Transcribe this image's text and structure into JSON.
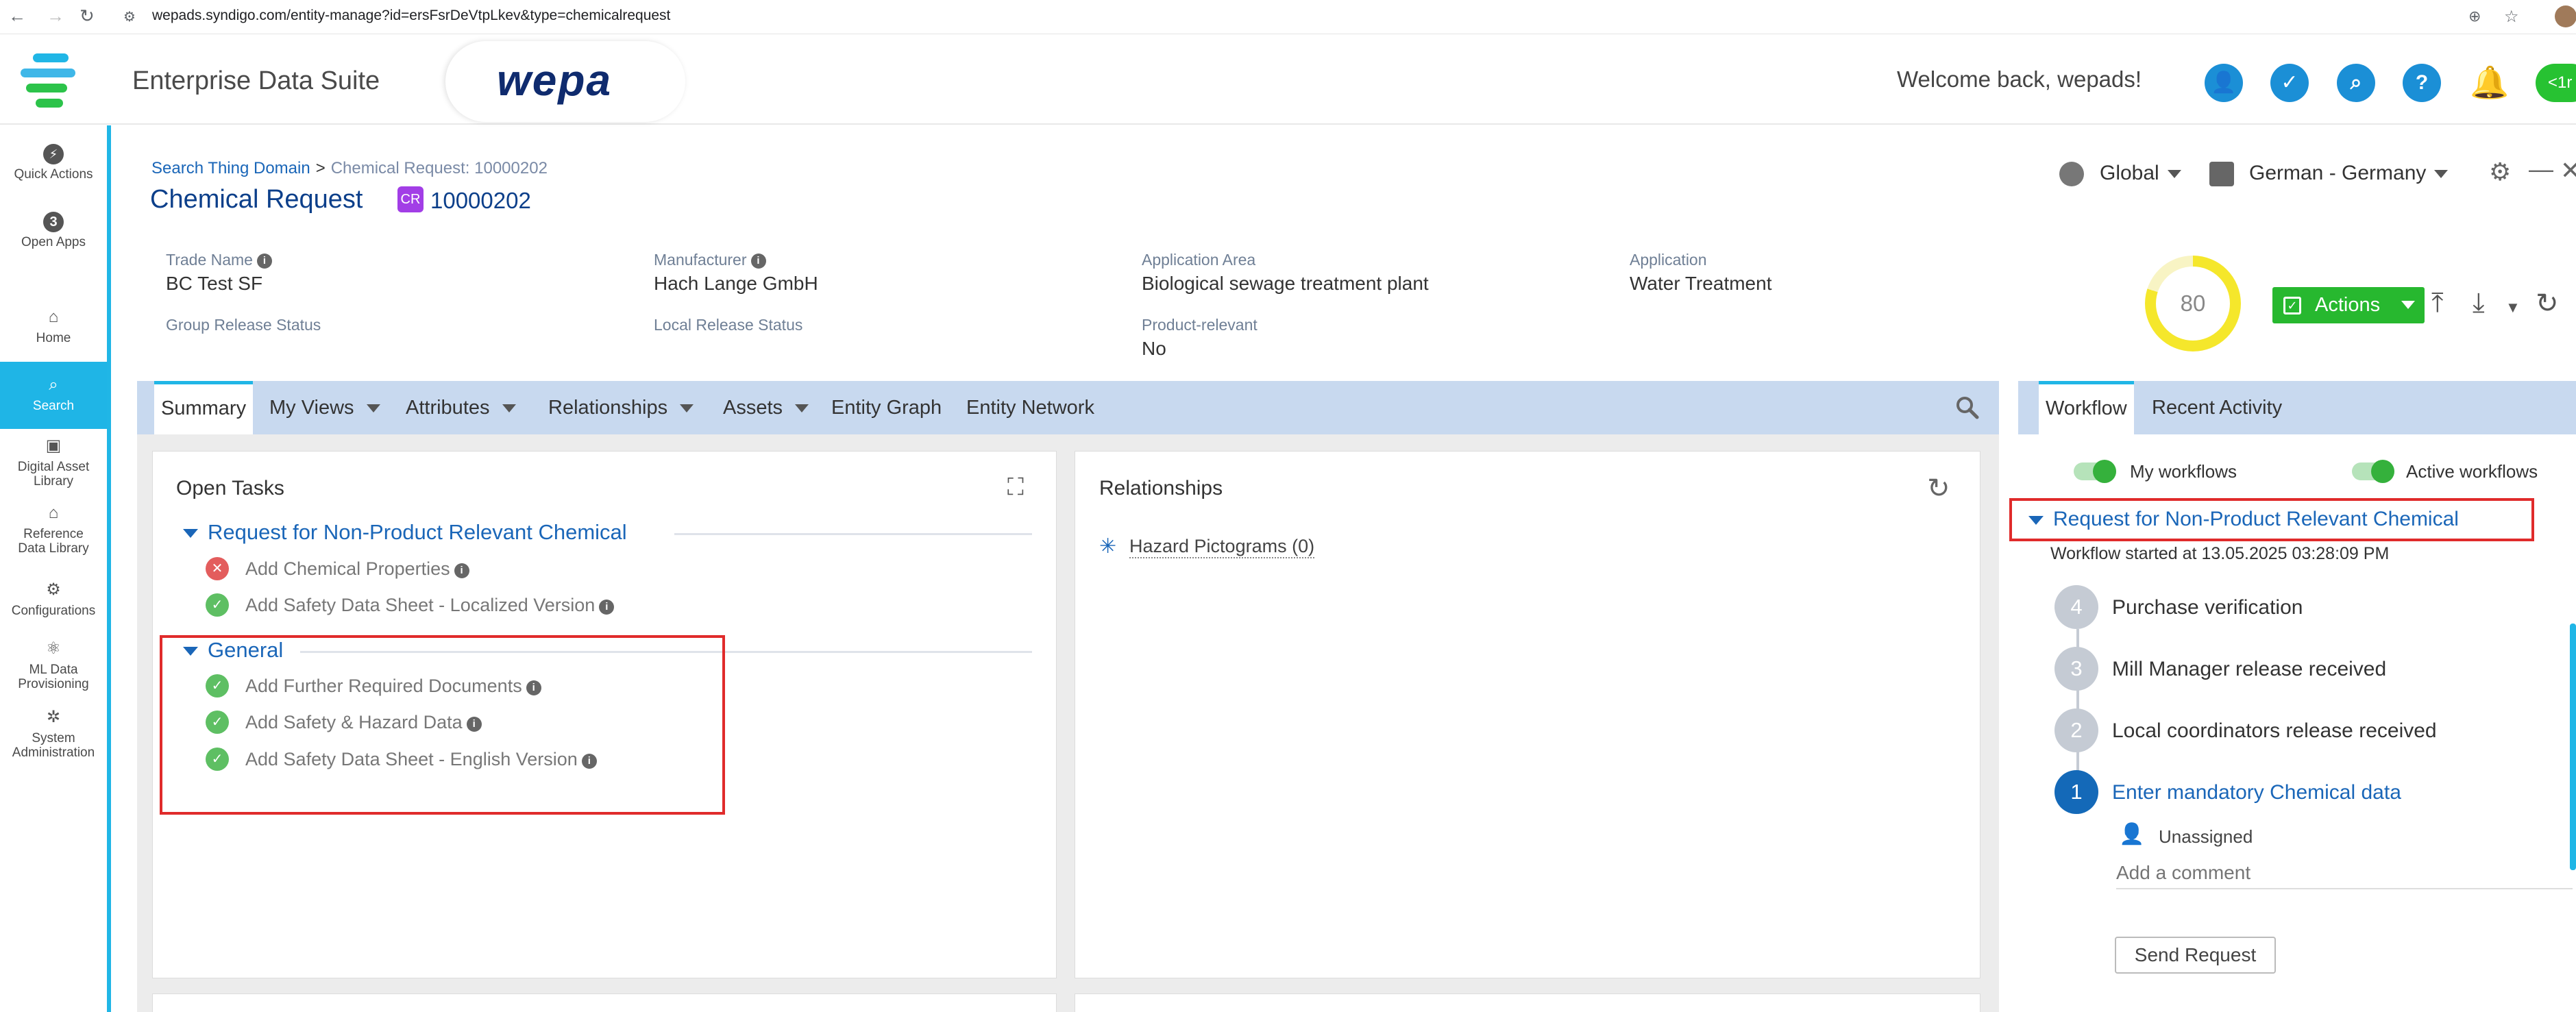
{
  "browser": {
    "url_host": "wepads.syndigo.com",
    "url_path": "/entity-manage?id=ersFsrDeVtpLkev&type=chemicalrequest"
  },
  "header": {
    "app_title": "Enterprise Data Suite",
    "brand_logo": "wepa",
    "welcome": "Welcome back, wepads!",
    "pill_label": "<1r"
  },
  "nav": {
    "quick_actions": "Quick Actions",
    "open_apps_count": "3",
    "open_apps": "Open Apps",
    "home": "Home",
    "search": "Search",
    "dal_line1": "Digital Asset",
    "dal_line2": "Library",
    "rdl_line1": "Reference",
    "rdl_line2": "Data Library",
    "configurations": "Configurations",
    "ml_line1": "ML Data",
    "ml_line2": "Provisioning",
    "sys_line1": "System",
    "sys_line2": "Administration"
  },
  "entity": {
    "breadcrumb_root": "Search Thing Domain",
    "breadcrumb_sep": ">",
    "breadcrumb_current": "Chemical Request: 10000202",
    "title": "Chemical Request",
    "badge": "CR",
    "id": "10000202",
    "context_scope": "Global",
    "context_locale": "German - Germany",
    "score": "80",
    "actions_label": "Actions"
  },
  "attributes": [
    {
      "label": "Trade Name",
      "value": "BC Test SF"
    },
    {
      "label": "Manufacturer",
      "value": "Hach Lange GmbH"
    },
    {
      "label": "Application Area",
      "value": "Biological sewage treatment plant"
    },
    {
      "label": "Application",
      "value": "Water Treatment"
    },
    {
      "label": "Group Release Status",
      "value": ""
    },
    {
      "label": "Local Release Status",
      "value": ""
    },
    {
      "label": "Product-relevant",
      "value": "No"
    }
  ],
  "tabs": {
    "summary": "Summary",
    "my_views": "My Views",
    "attributes": "Attributes",
    "relationships": "Relationships",
    "assets": "Assets",
    "entity_graph": "Entity Graph",
    "entity_network": "Entity Network"
  },
  "open_tasks": {
    "title": "Open Tasks",
    "groups": [
      {
        "name": "Request for Non-Product Relevant Chemical",
        "tasks": [
          {
            "label": "Add Chemical Properties",
            "status": "error"
          },
          {
            "label": "Add Safety Data Sheet - Localized Version",
            "status": "done"
          }
        ]
      },
      {
        "name": "General",
        "tasks": [
          {
            "label": "Add Further Required Documents",
            "status": "done"
          },
          {
            "label": "Add Safety & Hazard Data",
            "status": "done"
          },
          {
            "label": "Add Safety Data Sheet - English Version",
            "status": "done"
          }
        ]
      }
    ]
  },
  "relationships": {
    "title": "Relationships",
    "item": "Hazard Pictograms (0)"
  },
  "workflow": {
    "tab_workflow": "Workflow",
    "tab_recent": "Recent Activity",
    "toggle_my": "My workflows",
    "toggle_active": "Active workflows",
    "name": "Request for Non-Product Relevant Chemical",
    "started": "Workflow started at 13.05.2025 03:28:09 PM",
    "steps": [
      {
        "num": "4",
        "label": "Purchase verification"
      },
      {
        "num": "3",
        "label": "Mill Manager release received"
      },
      {
        "num": "2",
        "label": "Local coordinators release received"
      },
      {
        "num": "1",
        "label": "Enter mandatory Chemical data"
      }
    ],
    "assignee": "Unassigned",
    "comment_placeholder": "Add a comment",
    "send_button": "Send Request"
  },
  "colors": {
    "accent": "#20b6e6",
    "link": "#1a66b8",
    "actions_green": "#27b82f",
    "highlight_red": "#e02b2b"
  }
}
